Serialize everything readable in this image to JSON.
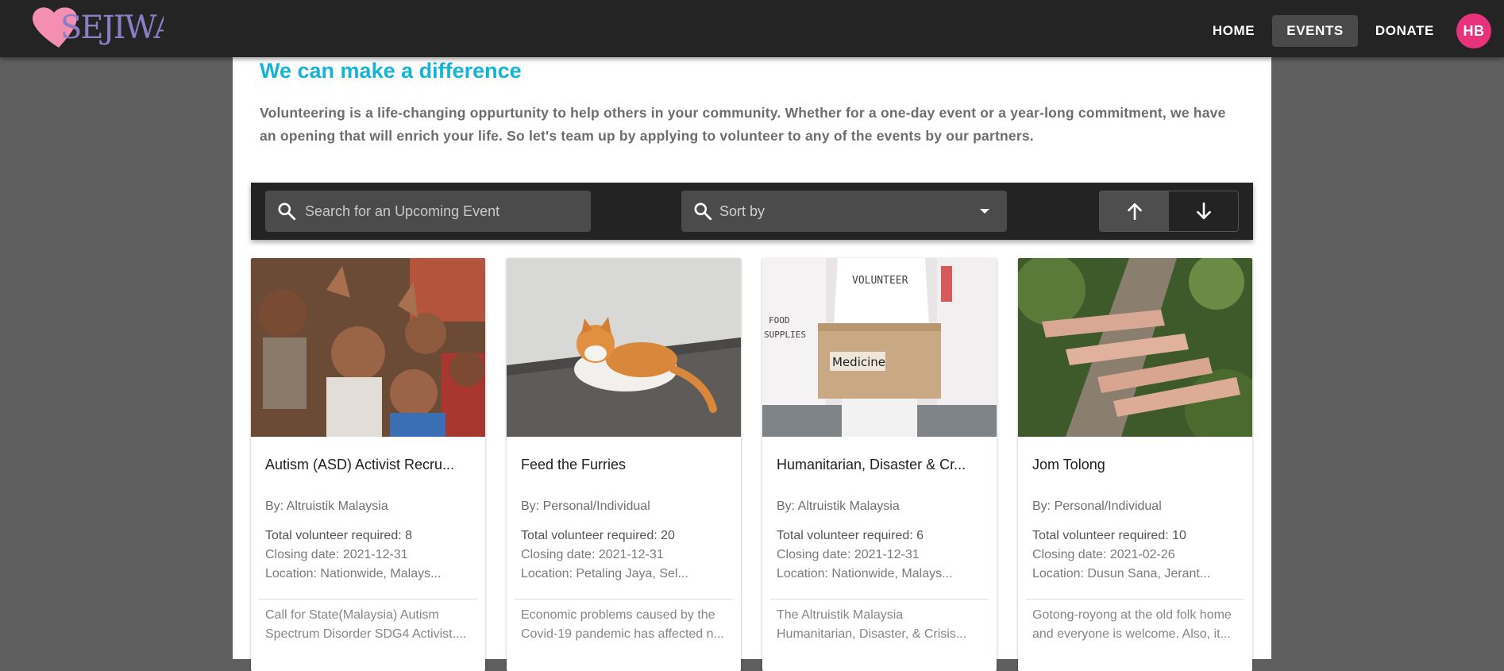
{
  "header": {
    "logo_text": "SEJIWA",
    "nav": [
      {
        "label": "HOME"
      },
      {
        "label": "EVENTS"
      },
      {
        "label": "DONATE"
      }
    ],
    "avatar_initials": "HB"
  },
  "main": {
    "heading": "We can make a difference",
    "intro": "Volunteering is a life-changing oppurtunity to help others in your community. Whether for a one-day event or a year-long commitment, we have an opening that will enrich your life. So let's team up by applying to volunteer to any of the events by our partners."
  },
  "toolbar": {
    "search_placeholder": "Search for an Upcoming Event",
    "sort_label": "Sort by",
    "sort_icon": "search-icon",
    "ascending_icon": "arrow-up-icon",
    "descending_icon": "arrow-down-icon"
  },
  "events": [
    {
      "title": "Autism (ASD) Activist Recru...",
      "org": "By: Altruistik Malaysia",
      "required": "Total volunteer required: 8",
      "closing": "Closing date: 2021-12-31",
      "location": "Location: Nationwide, Malays...",
      "description": "Call for State(Malaysia) Autism Spectrum Disorder SDG4 Activist...."
    },
    {
      "title": "Feed the Furries",
      "org": "By: Personal/Individual",
      "required": "Total volunteer required: 20",
      "closing": "Closing date: 2021-12-31",
      "location": "Location: Petaling Jaya, Sel...",
      "description": "Economic problems caused by the Covid-19 pandemic has affected n..."
    },
    {
      "title": "Humanitarian, Disaster & Cr...",
      "org": "By: Altruistik Malaysia",
      "required": "Total volunteer required: 6",
      "closing": "Closing date: 2021-12-31",
      "location": "Location: Nationwide, Malays...",
      "description": "The Altruistik Malaysia Humanitarian, Disaster, & Crisis..."
    },
    {
      "title": "Jom Tolong",
      "org": "By: Personal/Individual",
      "required": "Total volunteer required: 10",
      "closing": "Closing date: 2021-02-26",
      "location": "Location: Dusun Sana, Jerant...",
      "description": "Gotong-royong at the old folk home and everyone is welcome. Also, it..."
    }
  ],
  "photo_labels": {
    "volunteer_shirt": "VOLUNTEER",
    "food_sign": "FOOD SUPPLIES",
    "box_label": "Medicine"
  },
  "colors": {
    "accent": "#15b3d6",
    "avatar": "#e8327b",
    "appbar": "#242424",
    "background": "#5f5f5f"
  }
}
